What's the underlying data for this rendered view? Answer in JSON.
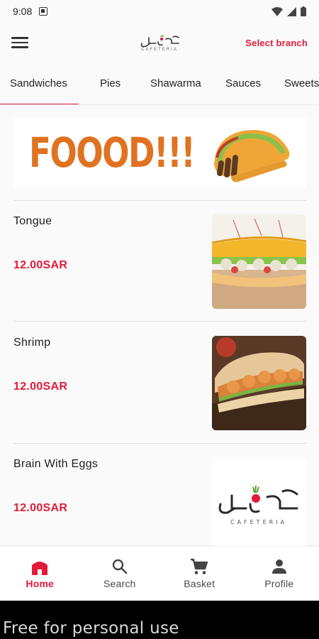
{
  "status_bar": {
    "time": "9:08"
  },
  "header": {
    "logo_sub": "CAFETERIA",
    "select_branch": "Select branch"
  },
  "tabs": [
    {
      "label": "Sandwiches",
      "active": true
    },
    {
      "label": "Pies",
      "active": false
    },
    {
      "label": "Shawarma",
      "active": false
    },
    {
      "label": "Sauces",
      "active": false
    },
    {
      "label": "Sweets",
      "active": false
    }
  ],
  "banner": {
    "text": "FOOOD!!!"
  },
  "items": [
    {
      "name": "Tongue",
      "price": "12.00SAR"
    },
    {
      "name": "Shrimp",
      "price": "12.00SAR"
    },
    {
      "name": "Brain With Eggs",
      "price": "12.00SAR"
    }
  ],
  "bottom_nav": [
    {
      "label": "Home",
      "icon": "home-icon",
      "active": true
    },
    {
      "label": "Search",
      "icon": "search-icon",
      "active": false
    },
    {
      "label": "Basket",
      "icon": "cart-icon",
      "active": false
    },
    {
      "label": "Profile",
      "icon": "person-icon",
      "active": false
    }
  ],
  "footer": {
    "text": "Free for personal use"
  },
  "colors": {
    "accent": "#e31b3b",
    "banner_text": "#e07322"
  }
}
